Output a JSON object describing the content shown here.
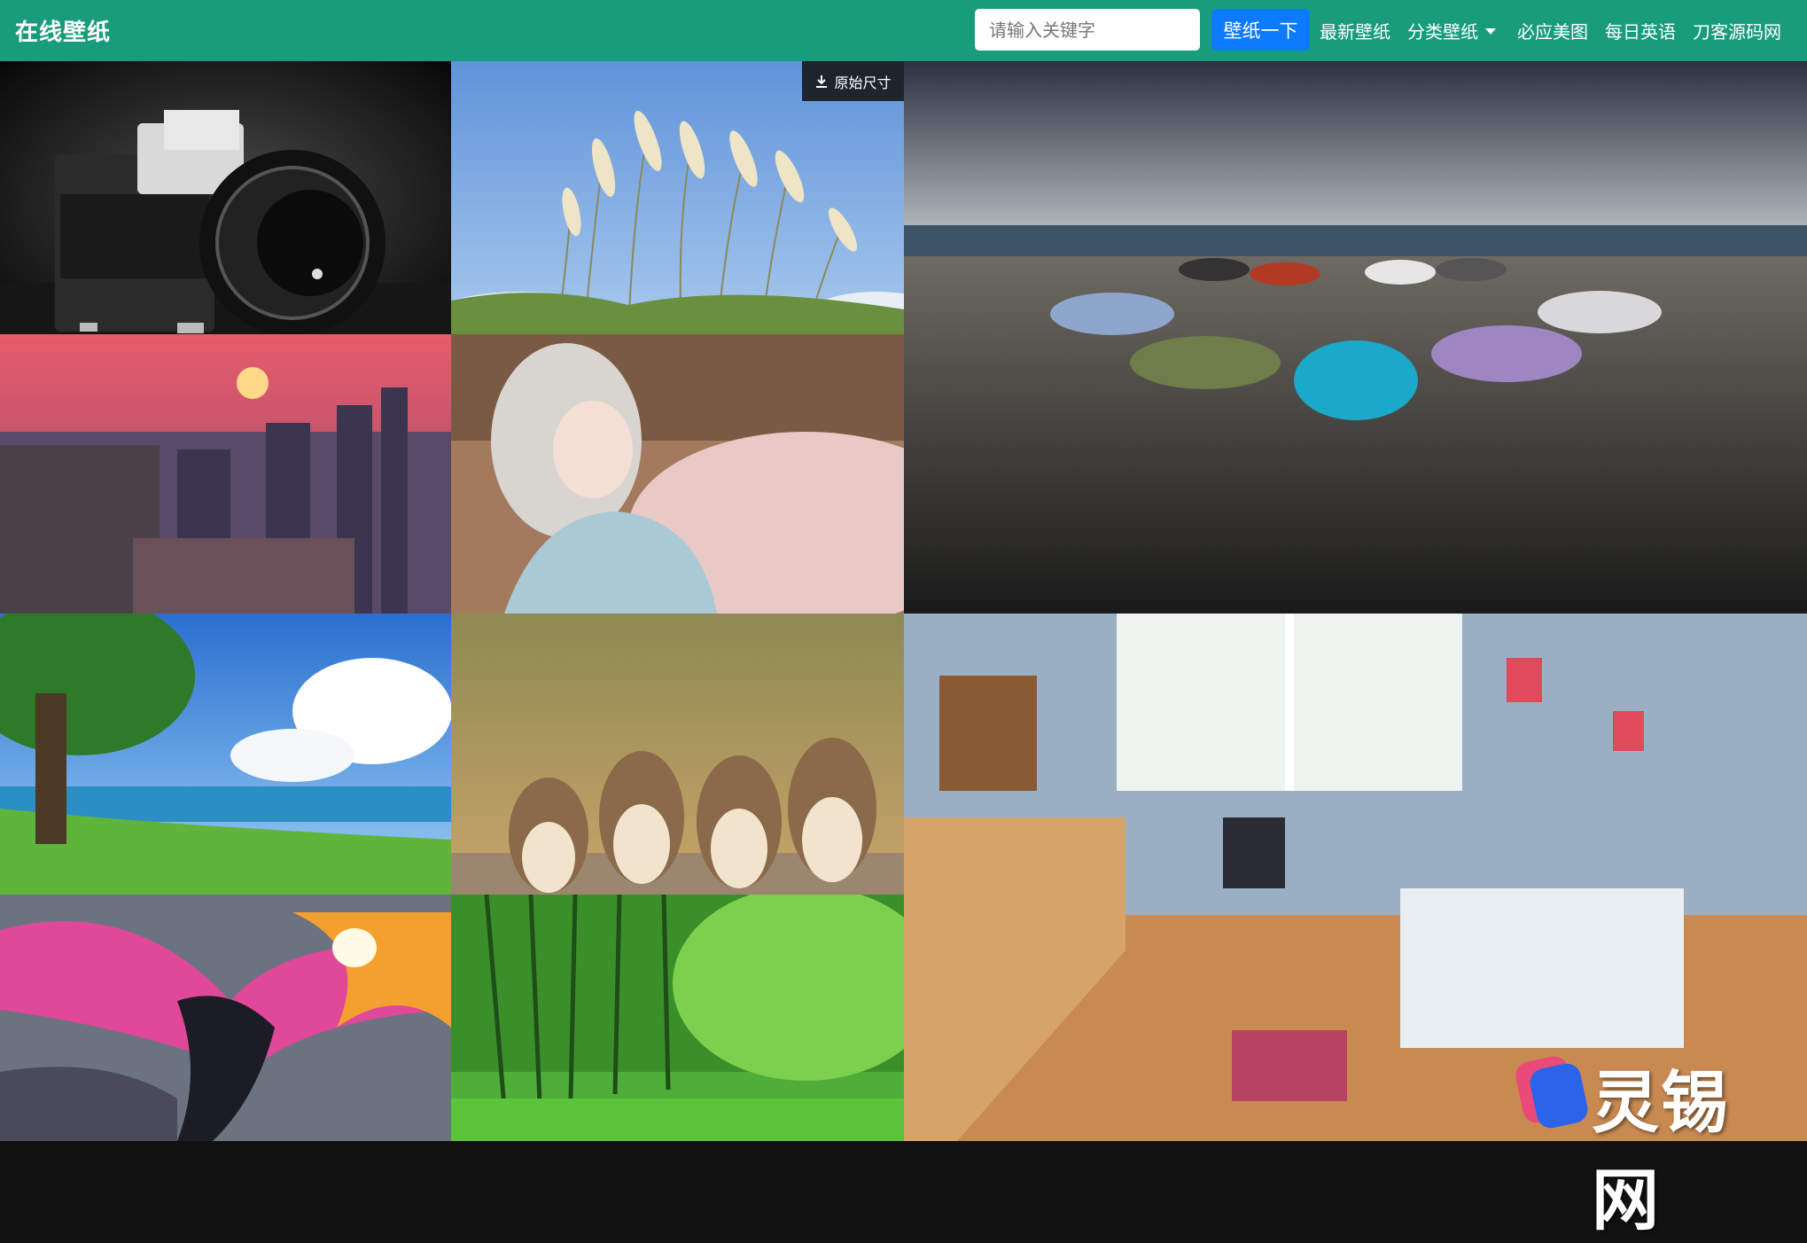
{
  "brand": "在线壁纸",
  "search": {
    "placeholder": "请输入关键字",
    "button_label": "壁纸一下"
  },
  "nav": {
    "latest": "最新壁纸",
    "category": "分类壁纸",
    "bing": "必应美图",
    "english": "每日英语",
    "source": "刀客源码网"
  },
  "tiles": {
    "download_label": "原始尺寸"
  },
  "watermark": {
    "text": "灵锡网"
  },
  "colors": {
    "navbar": "#189c7c",
    "search_button": "#0d7bff"
  }
}
